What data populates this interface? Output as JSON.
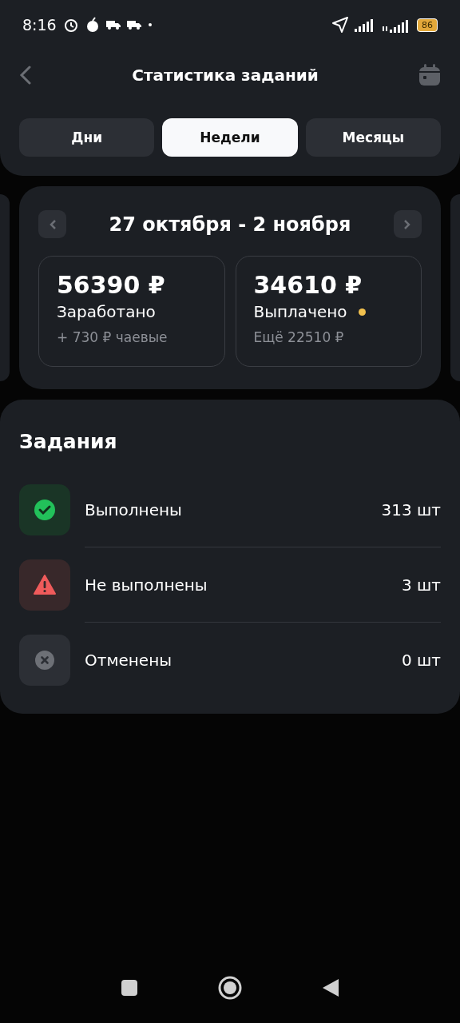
{
  "status_bar": {
    "time": "8:16",
    "battery": "86"
  },
  "header": {
    "title": "Статистика заданий"
  },
  "tabs": [
    {
      "label": "Дни",
      "selected": false
    },
    {
      "label": "Недели",
      "selected": true
    },
    {
      "label": "Месяцы",
      "selected": false
    }
  ],
  "period": {
    "title": "27 октября - 2 ноября",
    "cards": [
      {
        "amount": "56390 ₽",
        "label": "Заработано",
        "note": "+ 730 ₽ чаевые",
        "pending": false
      },
      {
        "amount": "34610 ₽",
        "label": "Выплачено",
        "note": "Ещё 22510 ₽",
        "pending": true
      }
    ]
  },
  "tasks": {
    "title": "Задания",
    "items": [
      {
        "kind": "done",
        "label": "Выполнены",
        "count": "313 шт"
      },
      {
        "kind": "failed",
        "label": "Не выполнены",
        "count": "3 шт"
      },
      {
        "kind": "cancelled",
        "label": "Отменены",
        "count": "0 шт"
      }
    ]
  }
}
